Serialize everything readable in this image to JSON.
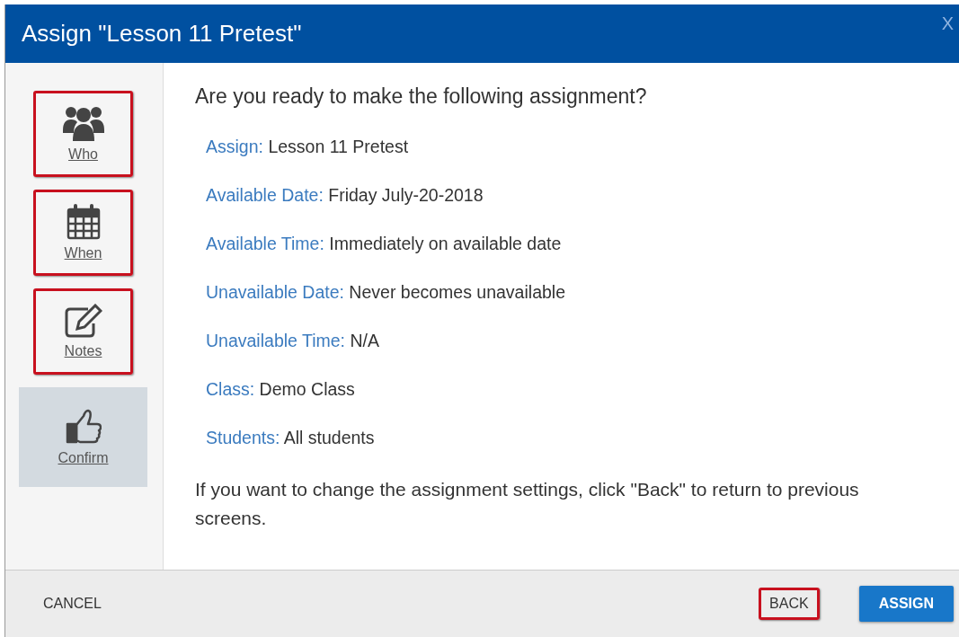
{
  "window": {
    "title": "Assign \"Lesson 11 Pretest\"",
    "close": "X"
  },
  "steps": [
    {
      "label": "Who",
      "kind": "people",
      "selected": false,
      "highlighted": true
    },
    {
      "label": "When",
      "kind": "calendar",
      "selected": false,
      "highlighted": true
    },
    {
      "label": "Notes",
      "kind": "edit",
      "selected": false,
      "highlighted": true
    },
    {
      "label": "Confirm",
      "kind": "thumb",
      "selected": true,
      "highlighted": false
    }
  ],
  "heading": "Are you ready to make the following assignment?",
  "details": [
    {
      "label": "Assign:",
      "value": "Lesson 11 Pretest"
    },
    {
      "label": "Available Date:",
      "value": "Friday July-20-2018"
    },
    {
      "label": "Available Time:",
      "value": "Immediately on available date"
    },
    {
      "label": "Unavailable Date:",
      "value": "Never becomes unavailable"
    },
    {
      "label": "Unavailable Time:",
      "value": "N/A"
    },
    {
      "label": "Class:",
      "value": "Demo Class"
    },
    {
      "label": "Students:",
      "value": "All students"
    }
  ],
  "note": "If you want to change the assignment settings, click \"Back\" to return to previous screens.",
  "buttons": [
    {
      "label": "CANCEL",
      "kind": "flat",
      "highlighted": false
    },
    {
      "label": "BACK",
      "kind": "flat",
      "highlighted": true
    },
    {
      "label": "ASSIGN",
      "kind": "primary",
      "highlighted": false
    }
  ]
}
